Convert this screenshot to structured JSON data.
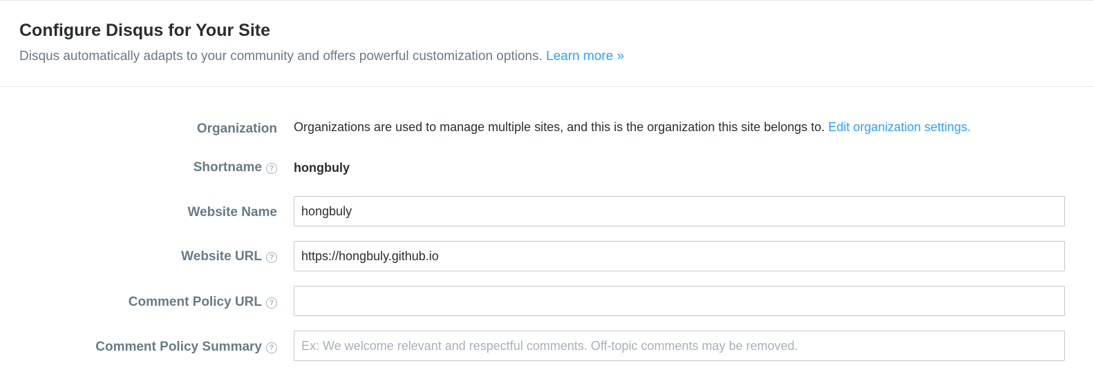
{
  "header": {
    "title": "Configure Disqus for Your Site",
    "subtitle": "Disqus automatically adapts to your community and offers powerful customization options.",
    "learn_more_link": "Learn more »"
  },
  "form": {
    "organization": {
      "label": "Organization",
      "description": "Organizations are used to manage multiple sites, and this is the organization this site belongs to.",
      "edit_link": "Edit organization settings."
    },
    "shortname": {
      "label": "Shortname",
      "value": "hongbuly",
      "help_icon": "question-circle-icon"
    },
    "website_name": {
      "label": "Website Name",
      "value": "hongbuly",
      "placeholder": ""
    },
    "website_url": {
      "label": "Website URL",
      "value": "https://hongbuly.github.io",
      "placeholder": "",
      "help_icon": "question-circle-icon"
    },
    "comment_policy_url": {
      "label": "Comment Policy URL",
      "value": "",
      "placeholder": "",
      "help_icon": "question-circle-icon"
    },
    "comment_policy_summary": {
      "label": "Comment Policy Summary",
      "value": "",
      "placeholder": "Ex: We welcome relevant and respectful comments. Off-topic comments may be removed.",
      "help_icon": "question-circle-icon"
    }
  },
  "colors": {
    "link": "#2e9fff",
    "label": "#687a86",
    "text": "#2a2e2e",
    "border": "#c2c6cc",
    "placeholder": "#a6b1b9"
  }
}
